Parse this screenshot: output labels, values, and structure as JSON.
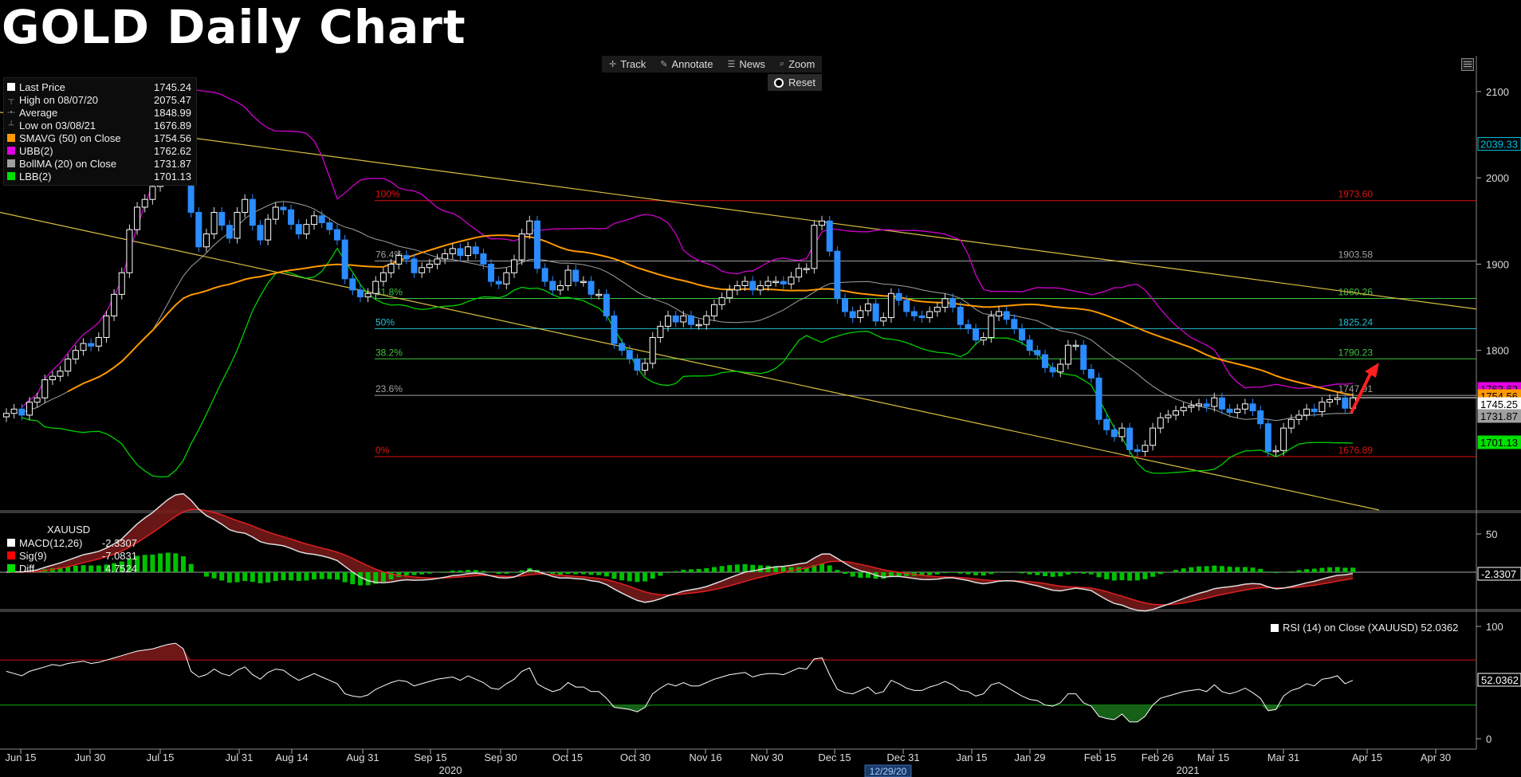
{
  "title": "GOLD Daily Chart",
  "toolbar": {
    "track": "Track",
    "annotate": "Annotate",
    "news": "News",
    "zoom": "Zoom",
    "reset": "Reset"
  },
  "legend": {
    "items": [
      {
        "label": "Last Price",
        "value": "1745.24",
        "color": "#ffffff"
      },
      {
        "label": "High on 08/07/20",
        "value": "2075.47"
      },
      {
        "label": "Average",
        "value": "1848.99"
      },
      {
        "label": "Low on 03/08/21",
        "value": "1676.89"
      },
      {
        "label": "SMAVG (50)  on Close",
        "value": "1754.56",
        "color": "#ff9900"
      },
      {
        "label": "UBB(2)",
        "value": "1762.62",
        "color": "#e000e0"
      },
      {
        "label": "BollMA (20)  on Close",
        "value": "1731.87",
        "color": "#a0a0a0"
      },
      {
        "label": "LBB(2)",
        "value": "1701.13",
        "color": "#00e000"
      }
    ]
  },
  "macd_legend": {
    "header": "XAUUSD",
    "items": [
      {
        "label": "MACD(12,26)",
        "value": "-2.3307",
        "color": "#ffffff"
      },
      {
        "label": "Sig(9)",
        "value": "-7.0831",
        "color": "#ff0000"
      },
      {
        "label": "Diff",
        "value": "4.7524",
        "color": "#00e000"
      }
    ]
  },
  "rsi_legend": "RSI (14)  on Close (XAUUSD) 52.0362",
  "chart_data": {
    "type": "candlestick",
    "y_axis_ticks": [
      1800,
      1900,
      2000,
      2100
    ],
    "ylim": [
      1615,
      2135
    ],
    "x_axis_ticks": [
      "Jun 15",
      "Jun 30",
      "Jul 15",
      "Jul 31",
      "Aug 14",
      "Aug 31",
      "Sep 15",
      "Sep 30",
      "Oct 15",
      "Oct 30",
      "Nov 16",
      "Nov 30",
      "Dec 15",
      "Dec 31",
      "Jan 15",
      "Jan 29",
      "Feb 15",
      "Feb 26",
      "Mar 15",
      "Mar 31",
      "Apr 15",
      "Apr 30"
    ],
    "year_labels": [
      "2020",
      "2021"
    ],
    "crosshair_date": "12/29/20",
    "fibonacci": [
      {
        "pct": "100%",
        "value": 1973.6,
        "label": "1973.60",
        "color": "#e01010"
      },
      {
        "pct": "76.4%",
        "value": 1903.58,
        "label": "1903.58",
        "color": "#a0a0a0"
      },
      {
        "pct": "61.8%",
        "value": 1860.26,
        "label": "1860.26",
        "color": "#40c040"
      },
      {
        "pct": "50%",
        "value": 1825.24,
        "label": "1825.24",
        "color": "#20c0d0"
      },
      {
        "pct": "38.2%",
        "value": 1790.23,
        "label": "1790.23",
        "color": "#40c040"
      },
      {
        "pct": "23.6%",
        "value": 1747.91,
        "label": "1747.91",
        "color": "#a0a0a0"
      },
      {
        "pct": "0%",
        "value": 1676.89,
        "label": "1676.89",
        "color": "#e01010"
      }
    ],
    "axis_tags": [
      {
        "label": "2039.33",
        "value": 2039.33,
        "color": "#ffffff",
        "text_color": "#00c0e0",
        "border": "#00c0e0"
      },
      {
        "label": "1763.62",
        "value": 1762.62,
        "color": "#e000e0",
        "text_color": "#000000"
      },
      {
        "label": "1754.56",
        "value": 1754.56,
        "color": "#ff9900",
        "text_color": "#000000"
      },
      {
        "label": "1745.25",
        "value": 1745.25,
        "color": "#ffffff",
        "text_color": "#000000"
      },
      {
        "label": "1731.87",
        "value": 1731.87,
        "color": "#a0a0a0",
        "text_color": "#000000"
      },
      {
        "label": "1701.13",
        "value": 1701.13,
        "color": "#00e000",
        "text_color": "#000000"
      }
    ],
    "macd_axis_ticks": [
      0,
      50
    ],
    "macd_tags": [
      {
        "label": "-2.3307",
        "color": "#ffffff"
      }
    ],
    "rsi_axis_ticks": [
      0,
      100
    ],
    "rsi_lines": [
      70,
      30
    ],
    "rsi_tag": "52.0362",
    "close_series": [
      1727,
      1732,
      1725,
      1740,
      1745,
      1766,
      1770,
      1776,
      1790,
      1800,
      1808,
      1805,
      1815,
      1840,
      1865,
      1890,
      1940,
      1966,
      1975,
      1990,
      2030,
      2055,
      2060,
      2040,
      1960,
      1920,
      1935,
      1960,
      1945,
      1930,
      1960,
      1975,
      1945,
      1928,
      1952,
      1966,
      1963,
      1946,
      1935,
      1946,
      1956,
      1948,
      1940,
      1928,
      1883,
      1870,
      1862,
      1866,
      1880,
      1890,
      1900,
      1910,
      1906,
      1890,
      1896,
      1900,
      1906,
      1912,
      1918,
      1910,
      1920,
      1912,
      1900,
      1880,
      1877,
      1890,
      1905,
      1935,
      1950,
      1895,
      1880,
      1870,
      1875,
      1893,
      1880,
      1880,
      1865,
      1865,
      1840,
      1808,
      1800,
      1790,
      1777,
      1785,
      1815,
      1828,
      1840,
      1833,
      1840,
      1830,
      1830,
      1840,
      1853,
      1861,
      1870,
      1875,
      1880,
      1870,
      1875,
      1880,
      1880,
      1877,
      1885,
      1895,
      1895,
      1945,
      1950,
      1915,
      1860,
      1845,
      1838,
      1846,
      1854,
      1834,
      1838,
      1866,
      1858,
      1845,
      1840,
      1838,
      1845,
      1850,
      1860,
      1850,
      1830,
      1825,
      1812,
      1815,
      1840,
      1845,
      1836,
      1825,
      1812,
      1800,
      1795,
      1780,
      1775,
      1784,
      1806,
      1806,
      1778,
      1768,
      1720,
      1708,
      1700,
      1710,
      1685,
      1683,
      1690,
      1710,
      1722,
      1725,
      1730,
      1734,
      1736,
      1738,
      1735,
      1745,
      1732,
      1728,
      1732,
      1738,
      1730,
      1715,
      1683,
      1684,
      1710,
      1720,
      1725,
      1732,
      1729,
      1740,
      1743,
      1745,
      1733,
      1745
    ],
    "rsi_series": [
      60,
      58,
      56,
      60,
      62,
      64,
      66,
      65,
      67,
      68,
      69,
      67,
      68,
      70,
      72,
      74,
      76,
      78,
      79,
      80,
      82,
      84,
      85,
      80,
      60,
      55,
      57,
      62,
      58,
      56,
      61,
      64,
      57,
      53,
      59,
      62,
      61,
      56,
      52,
      55,
      58,
      55,
      52,
      49,
      40,
      38,
      37,
      39,
      44,
      47,
      50,
      52,
      51,
      47,
      49,
      51,
      53,
      54,
      55,
      52,
      56,
      53,
      50,
      45,
      44,
      49,
      53,
      60,
      63,
      49,
      45,
      42,
      44,
      50,
      46,
      46,
      42,
      42,
      36,
      28,
      27,
      26,
      24,
      28,
      40,
      45,
      49,
      47,
      50,
      47,
      47,
      50,
      53,
      55,
      57,
      58,
      59,
      55,
      57,
      58,
      58,
      57,
      60,
      63,
      62,
      71,
      72,
      57,
      44,
      41,
      40,
      43,
      46,
      40,
      42,
      52,
      49,
      45,
      43,
      43,
      46,
      48,
      51,
      48,
      43,
      42,
      38,
      40,
      48,
      50,
      46,
      42,
      38,
      35,
      34,
      30,
      29,
      32,
      40,
      40,
      32,
      29,
      20,
      18,
      17,
      22,
      15,
      15,
      20,
      30,
      36,
      38,
      40,
      42,
      43,
      44,
      42,
      48,
      42,
      40,
      42,
      45,
      41,
      36,
      25,
      26,
      38,
      43,
      45,
      49,
      47,
      53,
      54,
      56,
      49,
      52
    ]
  }
}
